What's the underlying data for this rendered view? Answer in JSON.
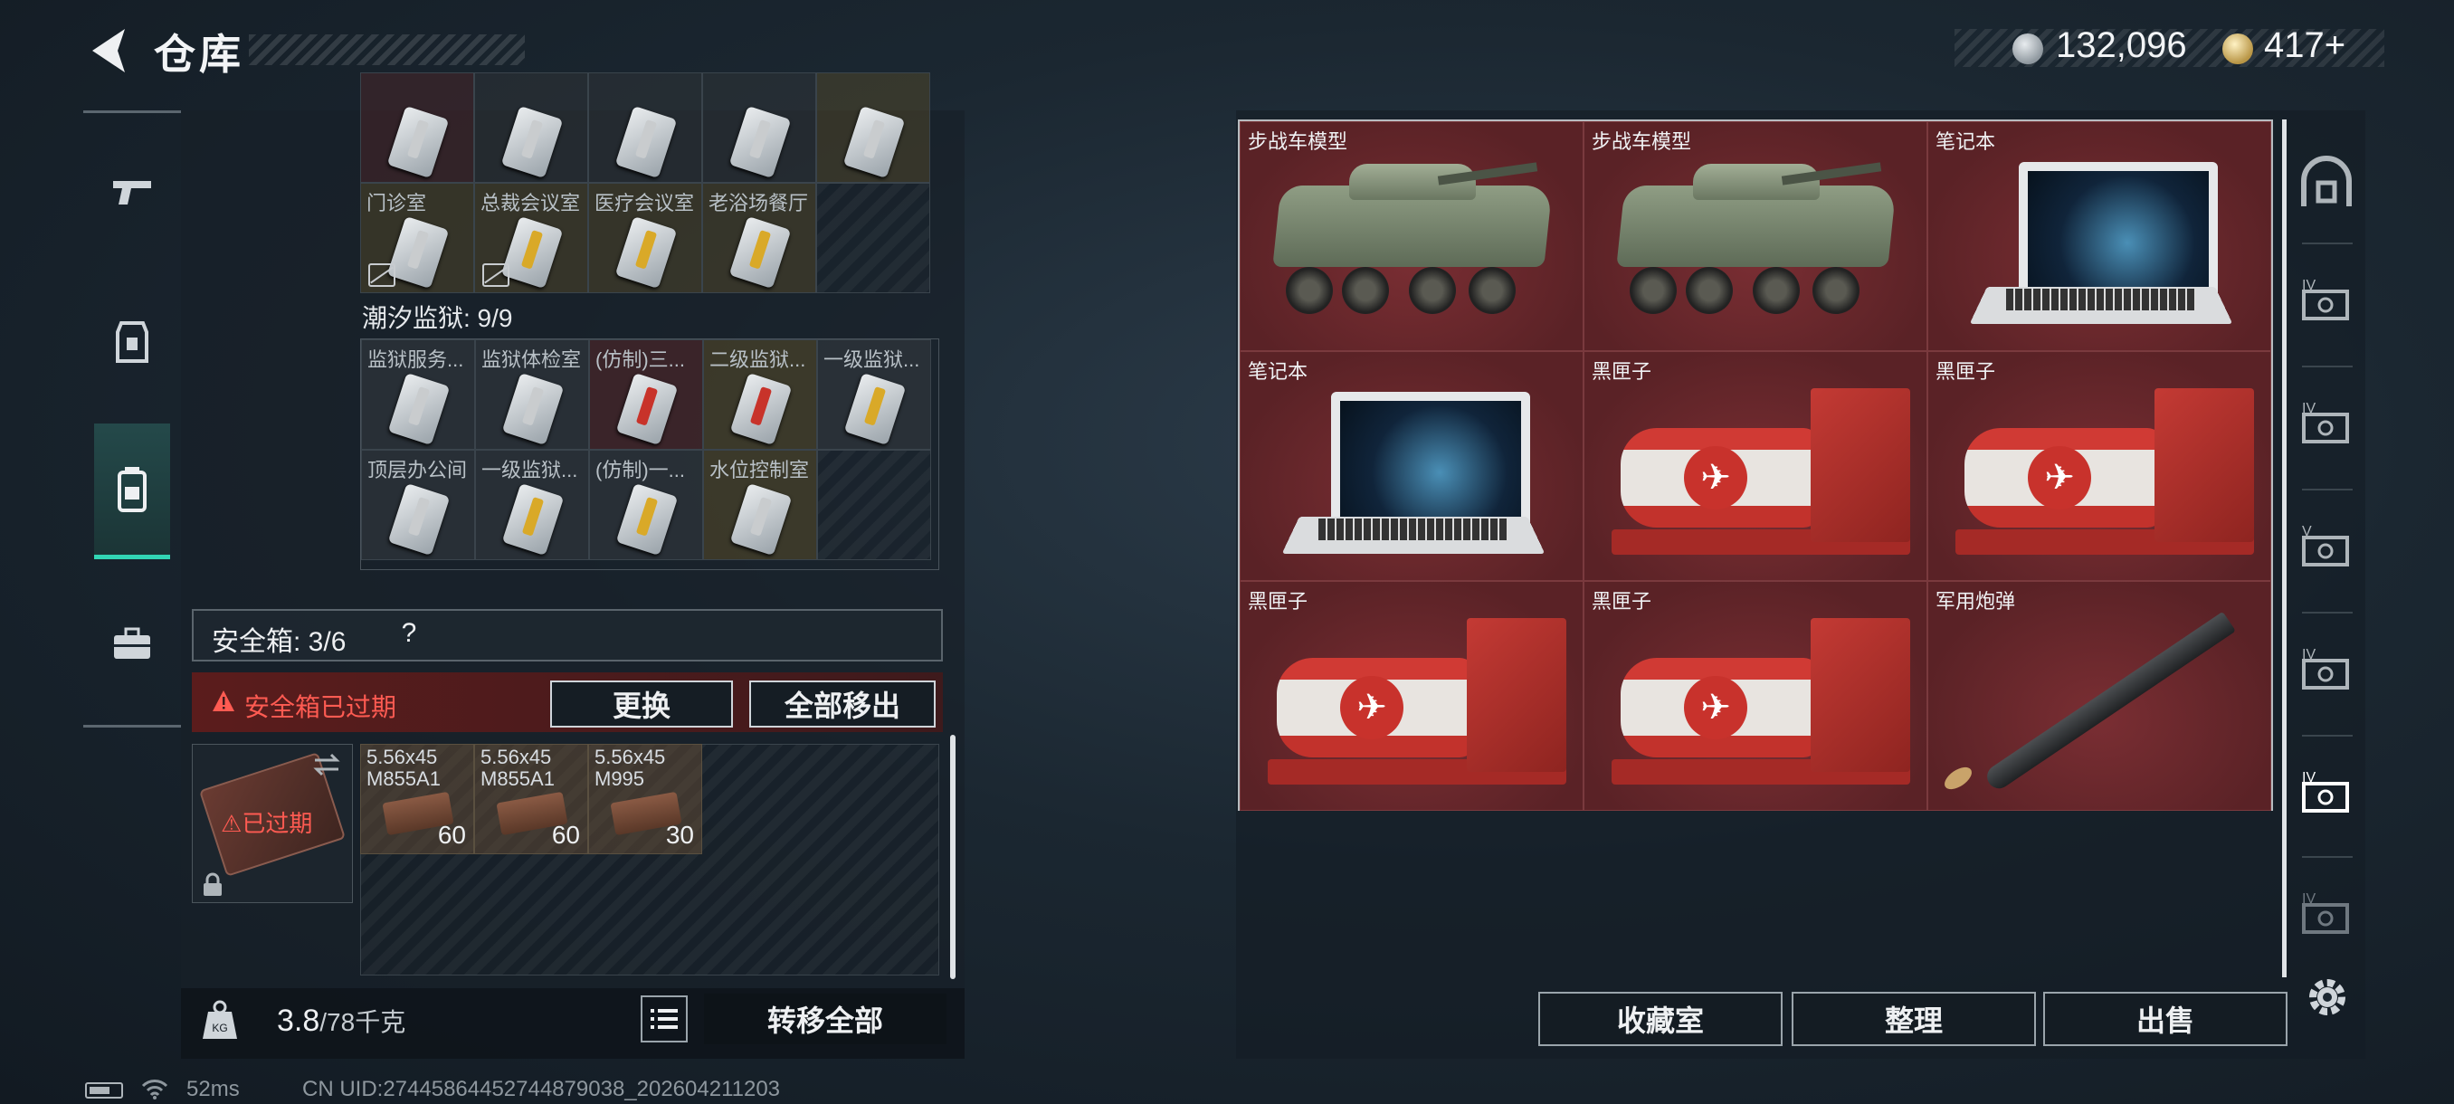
{
  "header": {
    "title": "仓库",
    "money": "132,096",
    "gold": "417+"
  },
  "left": {
    "top_row_labels": [
      "门诊室",
      "总裁会议室",
      "医疗会议室",
      "老浴场餐厅"
    ],
    "section_label": "潮汐监狱: 9/9",
    "prison_row1": [
      "监狱服务...",
      "监狱体检室",
      "(仿制)三...",
      "二级监狱...",
      "一级监狱..."
    ],
    "prison_row2": [
      "顶层办公间",
      "一级监狱...",
      "(仿制)一...",
      "水位控制室"
    ],
    "safe_label": "安全箱: 3/6",
    "help": "?",
    "expired_warning": "安全箱已过期",
    "swap_button": "更换",
    "move_all_button": "全部移出",
    "case_expired": "已过期",
    "ammo": [
      {
        "label": "5.56x45\nM855A1",
        "qty": "60"
      },
      {
        "label": "5.56x45\nM855A1",
        "qty": "60"
      },
      {
        "label": "5.56x45\nM995",
        "qty": "30"
      }
    ],
    "weight": "3.8",
    "weight_max": "/78千克",
    "transfer_all": "转移全部"
  },
  "right": {
    "tiles": [
      {
        "label": "步战车模型",
        "icon": "ifv-model"
      },
      {
        "label": "步战车模型",
        "icon": "ifv-model"
      },
      {
        "label": "笔记本",
        "icon": "laptop"
      },
      {
        "label": "笔记本",
        "icon": "laptop"
      },
      {
        "label": "黑匣子",
        "icon": "black-box"
      },
      {
        "label": "黑匣子",
        "icon": "black-box"
      },
      {
        "label": "黑匣子",
        "icon": "black-box"
      },
      {
        "label": "黑匣子",
        "icon": "black-box"
      },
      {
        "label": "军用炮弹",
        "icon": "artillery-shell"
      }
    ],
    "rail_tabs": [
      "IV",
      "IV",
      "V",
      "IV",
      "IV"
    ],
    "collection_button": "收藏室",
    "sort_button": "整理",
    "sell_button": "出售"
  },
  "status": {
    "ping": "52ms",
    "uid": "CN UID:2744586445274487903​8_202604211203"
  },
  "colors": {
    "accent": "#32d6b4",
    "warning": "#ff5b52",
    "item_bg": "#5b2428"
  }
}
